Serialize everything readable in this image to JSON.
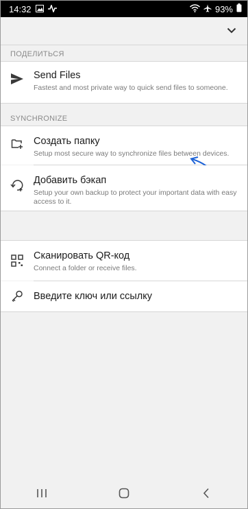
{
  "status_bar": {
    "time": "14:32",
    "battery": "93%"
  },
  "sections": {
    "share": {
      "label": "ПОДЕЛИТЬСЯ"
    },
    "sync": {
      "label": "SYNCHRONIZE"
    }
  },
  "items": {
    "send_files": {
      "title": "Send Files",
      "subtitle": "Fastest and most private way to quick send files to someone."
    },
    "create_folder": {
      "title": "Создать папку",
      "subtitle": "Setup most secure way to synchronize files between devices."
    },
    "add_backup": {
      "title": "Добавить бэкап",
      "subtitle": "Setup your own backup to protect your important data with easy access to it."
    },
    "scan_qr": {
      "title": "Сканировать QR-код",
      "subtitle": "Connect a folder or receive files."
    },
    "enter_key": {
      "title": "Введите ключ или ссылку"
    }
  },
  "colors": {
    "annotation_arrow": "#1e63d6",
    "status_bar": "#000000"
  },
  "icons": [
    "image-icon",
    "activity-icon",
    "wifi-icon",
    "airplane-icon",
    "battery-icon",
    "chevron-down-icon",
    "send-icon",
    "folder-add-icon",
    "backup-restore-icon",
    "qr-code-icon",
    "key-icon",
    "recents-icon",
    "home-icon",
    "back-icon"
  ]
}
